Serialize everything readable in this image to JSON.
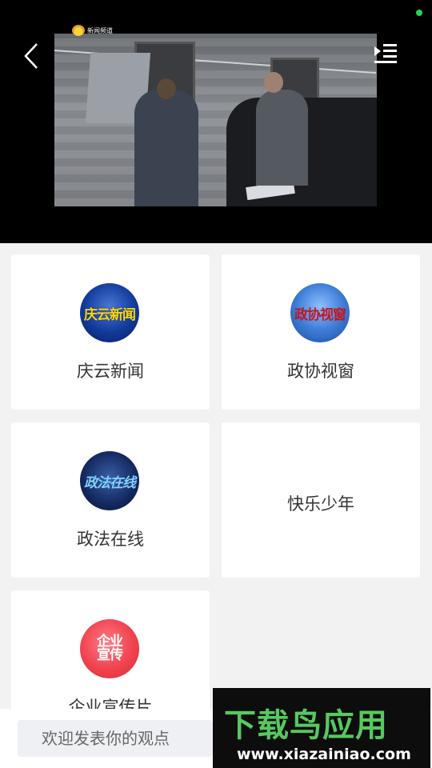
{
  "video": {
    "channel_logo_text": "新闻频道"
  },
  "channels": [
    {
      "label": "庆云新闻",
      "logo_text": "庆云新闻",
      "logo_style": "blue"
    },
    {
      "label": "政协视窗",
      "logo_text": "政协视窗",
      "logo_style": "lightblue"
    },
    {
      "label": "政法在线",
      "logo_text": "政法在线",
      "logo_style": "navy"
    },
    {
      "label": "快乐少年",
      "logo_text": "",
      "logo_style": "none"
    },
    {
      "label": "企业宣传片",
      "logo_text": "企业\n宣传",
      "logo_style": "red"
    }
  ],
  "comment": {
    "placeholder": "欢迎发表你的观点"
  },
  "watermark": {
    "title": "下载鸟应用",
    "url": "www.xiazainiao.com"
  },
  "colors": {
    "status_dot": "#2bd24a",
    "watermark_green": "#57c95f"
  }
}
